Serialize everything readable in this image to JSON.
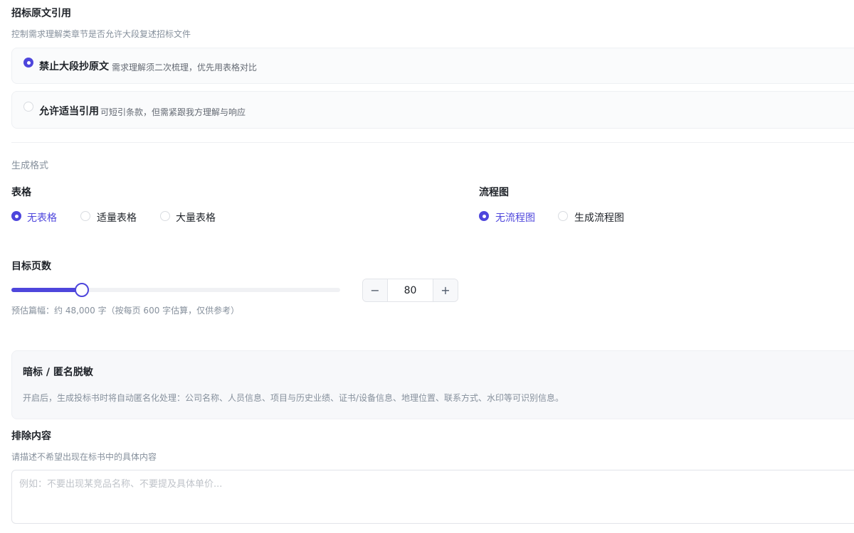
{
  "citation": {
    "title": "招标原文引用",
    "subtitle": "控制需求理解类章节是否允许大段复述招标文件",
    "options": [
      {
        "label": "禁止大段抄原文",
        "desc": "需求理解须二次梳理，优先用表格对比",
        "checked": true
      },
      {
        "label": "允许适当引用",
        "desc": "可短引条款，但需紧跟我方理解与响应",
        "checked": false
      }
    ]
  },
  "format": {
    "title": "生成格式",
    "table": {
      "label": "表格",
      "options": [
        "无表格",
        "适量表格",
        "大量表格"
      ],
      "selected": "无表格"
    },
    "flowchart": {
      "label": "流程图",
      "options": [
        "无流程图",
        "生成流程图"
      ],
      "selected": "无流程图"
    }
  },
  "pages": {
    "label": "目标页数",
    "value": "80",
    "min_symbol": "−",
    "plus_symbol": "+",
    "slider_fraction": 0.215,
    "estimate": "预估篇幅：约 48,000 字（按每页 600 字估算，仅供参考）"
  },
  "anonymize": {
    "title": "暗标 / 匿名脱敏",
    "desc": "开启后，生成投标书时将自动匿名化处理：公司名称、人员信息、项目与历史业绩、证书/设备信息、地理位置、联系方式、水印等可识别信息。"
  },
  "exclude": {
    "title": "排除内容",
    "subtitle": "请描述不希望出现在标书中的具体内容",
    "placeholder": "例如：不要出现某竞品名称、不要提及具体单价...",
    "value": ""
  },
  "colors": {
    "accent": "#4e46dc"
  }
}
